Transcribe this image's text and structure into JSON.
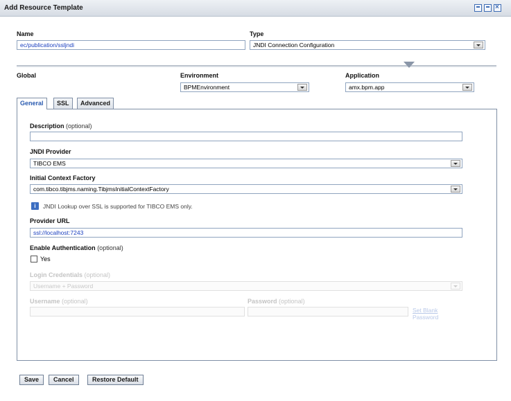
{
  "window": {
    "title": "Add Resource Template"
  },
  "name": {
    "label": "Name",
    "value": "ec/publication/ssljndi"
  },
  "type": {
    "label": "Type",
    "value": "JNDI Connection Configuration"
  },
  "scope": {
    "global_label": "Global",
    "environment_label": "Environment",
    "environment_value": "BPMEnvironment",
    "application_label": "Application",
    "application_value": "amx.bpm.app"
  },
  "tabs": [
    {
      "label": "General",
      "active": true
    },
    {
      "label": "SSL",
      "active": false
    },
    {
      "label": "Advanced",
      "active": false
    }
  ],
  "general": {
    "description_label": "Description",
    "description_optional": "(optional)",
    "description_value": "",
    "jndi_provider_label": "JNDI Provider",
    "jndi_provider_value": "TIBCO EMS",
    "initial_context_factory_label": "Initial Context Factory",
    "initial_context_factory_value": "com.tibco.tibjms.naming.TibjmsInitialContextFactory",
    "info_message": "JNDI Lookup over SSL is supported for TIBCO EMS only.",
    "info_icon": "info-icon",
    "provider_url_label": "Provider URL",
    "provider_url_value": "ssl://localhost:7243",
    "enable_auth_label": "Enable Authentication",
    "enable_auth_optional": "(optional)",
    "enable_auth_checkbox_label": "Yes",
    "enable_auth_checked": false,
    "login_credentials_label": "Login Credentials",
    "login_credentials_optional": "(optional)",
    "login_credentials_value": "Username + Password",
    "username_label": "Username",
    "username_optional": "(optional)",
    "username_value": "",
    "password_label": "Password",
    "password_optional": "(optional)",
    "password_value": "",
    "set_blank_password_link": "Set Blank Password"
  },
  "buttons": {
    "save": "Save",
    "cancel": "Cancel",
    "restore_default": "Restore Default"
  },
  "colors": {
    "accent": "#2a5bb0",
    "link_value": "#1a3fbf",
    "border": "#7f8fa6"
  }
}
